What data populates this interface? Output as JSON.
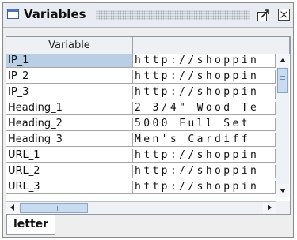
{
  "window": {
    "title": "Variables",
    "title_icon": "table-window-icon",
    "float_icon": "undock-icon",
    "close_icon": "close-icon"
  },
  "table": {
    "columns": [
      "Variable",
      ""
    ],
    "rows": [
      {
        "name": "IP_1",
        "value": "http://shoppin",
        "selected": true
      },
      {
        "name": "IP_2",
        "value": "http://shoppin",
        "selected": false
      },
      {
        "name": "IP_3",
        "value": "http://shoppin",
        "selected": false
      },
      {
        "name": "Heading_1",
        "value": "2 3/4\" Wood Te",
        "selected": false
      },
      {
        "name": "Heading_2",
        "value": "5000 Full Set",
        "selected": false
      },
      {
        "name": "Heading_3",
        "value": "Men's Cardiff",
        "selected": false
      },
      {
        "name": "URL_1",
        "value": "http://shoppin",
        "selected": false
      },
      {
        "name": "URL_2",
        "value": "http://shoppin",
        "selected": false
      },
      {
        "name": "URL_3",
        "value": "http://shoppin",
        "selected": false
      }
    ]
  },
  "tabs": [
    {
      "label": "letter",
      "active": true
    }
  ],
  "colors": {
    "selection": "#b8cfe5",
    "scroll_thumb": "#c9dbee"
  }
}
